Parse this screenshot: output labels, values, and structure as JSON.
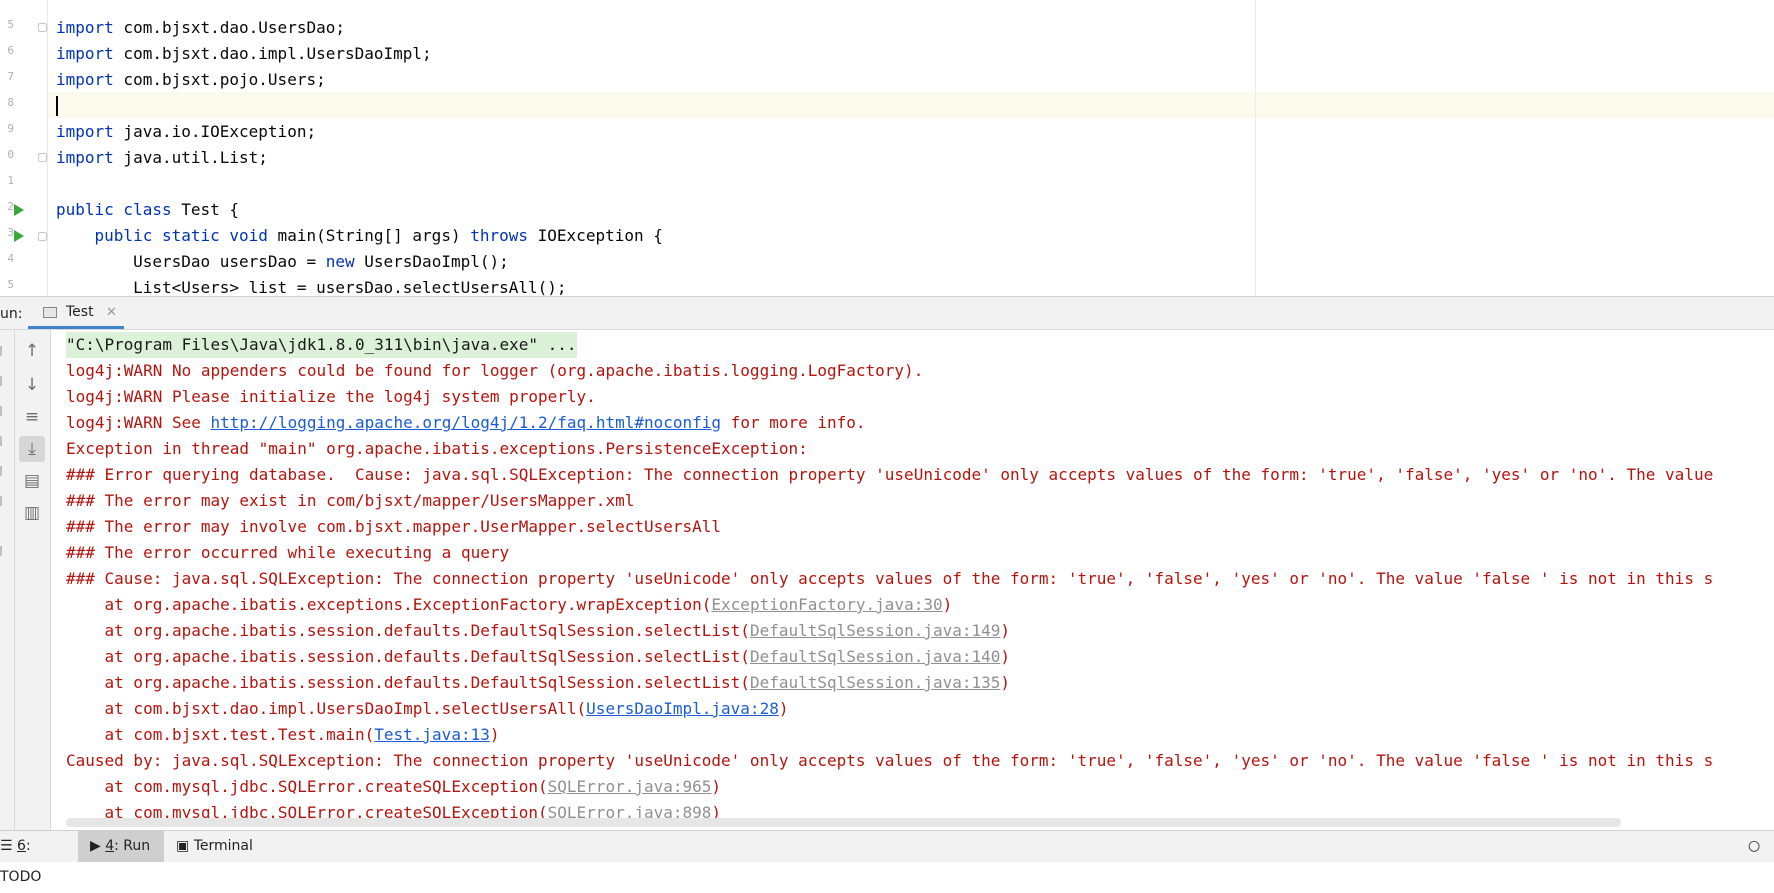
{
  "editor": {
    "line_numbers": [
      "5",
      "6",
      "7",
      "8",
      "9",
      "0",
      "1",
      "2",
      "3",
      "4",
      "5"
    ],
    "lines": [
      {
        "kw": "import",
        "rest": " com.bjsxt.dao.UsersDao;"
      },
      {
        "kw": "import",
        "rest": " com.bjsxt.dao.impl.UsersDaoImpl;"
      },
      {
        "kw": "import",
        "rest": " com.bjsxt.pojo.Users;"
      },
      {
        "kw": "",
        "rest": ""
      },
      {
        "kw": "import",
        "rest": " java.io.IOException;"
      },
      {
        "kw": "import",
        "rest": " java.util.List;"
      },
      {
        "kw": "",
        "rest": ""
      },
      {
        "kw": "public class",
        "rest": " Test {"
      },
      {
        "pre": "    ",
        "kw": "public static void",
        "rest": " main(String[] args) ",
        "kw2": "throws",
        "rest2": " IOException {"
      },
      {
        "pre": "        UsersDao usersDao = ",
        "kw": "new",
        "rest": " UsersDaoImpl();"
      },
      {
        "pre": "",
        "kw": "",
        "rest": "        List<Users> list = usersDao.selectUsersAll();"
      }
    ]
  },
  "run_panel": {
    "label": "un:",
    "tab_label": "Test",
    "tab_close": "✕"
  },
  "toolbar_icons": [
    "up-arrow-icon",
    "down-arrow-icon",
    "soft-wrap-icon",
    "scroll-to-end-icon",
    "print-icon",
    "trash-icon"
  ],
  "console": {
    "command": "\"C:\\Program Files\\Java\\jdk1.8.0_311\\bin\\java.exe\" ...",
    "warn1": "log4j:WARN No appenders could be found for logger (org.apache.ibatis.logging.LogFactory).",
    "warn2": "log4j:WARN Please initialize the log4j system properly.",
    "warn3_pre": "log4j:WARN See ",
    "warn3_link": "http://logging.apache.org/log4j/1.2/faq.html#noconfig",
    "warn3_post": " for more info.",
    "exception": "Exception in thread \"main\" org.apache.ibatis.exceptions.PersistenceException: ",
    "err1": "### Error querying database.  Cause: java.sql.SQLException: The connection property 'useUnicode' only accepts values of the form: 'true', 'false', 'yes' or 'no'. The value",
    "err2": "### The error may exist in com/bjsxt/mapper/UsersMapper.xml",
    "err3": "### The error may involve com.bjsxt.mapper.UserMapper.selectUsersAll",
    "err4": "### The error occurred while executing a query",
    "err5": "### Cause: java.sql.SQLException: The connection property 'useUnicode' only accepts values of the form: 'true', 'false', 'yes' or 'no'. The value 'false ' is not in this s",
    "stack": [
      {
        "pre": "    at org.apache.ibatis.exceptions.ExceptionFactory.wrapException(",
        "link": "ExceptionFactory.java:30",
        "post": ")",
        "blue": false
      },
      {
        "pre": "    at org.apache.ibatis.session.defaults.DefaultSqlSession.selectList(",
        "link": "DefaultSqlSession.java:149",
        "post": ")",
        "blue": false
      },
      {
        "pre": "    at org.apache.ibatis.session.defaults.DefaultSqlSession.selectList(",
        "link": "DefaultSqlSession.java:140",
        "post": ")",
        "blue": false
      },
      {
        "pre": "    at org.apache.ibatis.session.defaults.DefaultSqlSession.selectList(",
        "link": "DefaultSqlSession.java:135",
        "post": ")",
        "blue": false
      },
      {
        "pre": "    at com.bjsxt.dao.impl.UsersDaoImpl.selectUsersAll(",
        "link": "UsersDaoImpl.java:28",
        "post": ")",
        "blue": true
      },
      {
        "pre": "    at com.bjsxt.test.Test.main(",
        "link": "Test.java:13",
        "post": ")",
        "blue": true
      }
    ],
    "caused_by": "Caused by: java.sql.SQLException: The connection property 'useUnicode' only accepts values of the form: 'true', 'false', 'yes' or 'no'. The value 'false ' is not in this s",
    "stack2": [
      {
        "pre": "    at com.mysql.jdbc.SQLError.createSQLException(",
        "link": "SQLError.java:965",
        "post": ")"
      },
      {
        "pre": "    at com.mysql.jdbc.SQLError.createSQLException(",
        "link": "SQLError.java:898",
        "post": ")"
      }
    ]
  },
  "statusbar": {
    "todo_num": "6",
    "todo_label": ": TODO",
    "run_num": "4",
    "run_label": ": Run",
    "terminal_label": "Terminal"
  }
}
